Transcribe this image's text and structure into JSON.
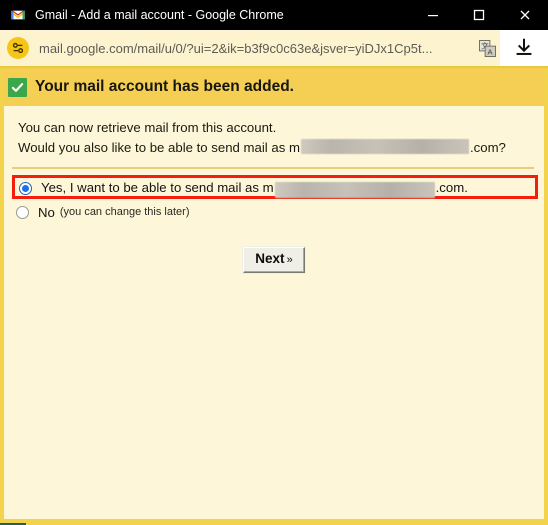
{
  "window": {
    "title": "Gmail - Add a mail account - Google Chrome",
    "app_icon": "gmail-m-icon",
    "controls": {
      "minimize": "minimize-icon",
      "maximize": "maximize-icon",
      "close": "close-icon"
    }
  },
  "urlbar": {
    "site_icon": "tune-settings-icon",
    "url": "mail.google.com/mail/u/0/?ui=2&ik=b3f9c0c63e&jsver=yiDJx1Cp5t...",
    "translate_icon": "translate-icon",
    "download_icon": "download-icon"
  },
  "banner": {
    "icon": "green-check-icon",
    "text": "Your mail account has been added."
  },
  "body": {
    "line1": "You can now retrieve mail from this account.",
    "line2_prefix": "Would you also like to be able to send mail as m",
    "line2_suffix": ".com?"
  },
  "options": {
    "yes": {
      "label_prefix": "Yes, I want to be able to send mail as m",
      "label_suffix": ".com.",
      "selected": true
    },
    "no": {
      "label": "No",
      "hint": "(you can change this later)",
      "selected": false
    }
  },
  "actions": {
    "next_label": "Next",
    "next_chevron": "»"
  },
  "colors": {
    "banner_bg": "#f5cf54",
    "page_bg": "#fdf6d8",
    "border": "#f3d34c",
    "highlight": "#f51d0c",
    "check_green": "#3aa74a",
    "radio_blue": "#1a73e8",
    "titlebar_bg": "#000000"
  }
}
